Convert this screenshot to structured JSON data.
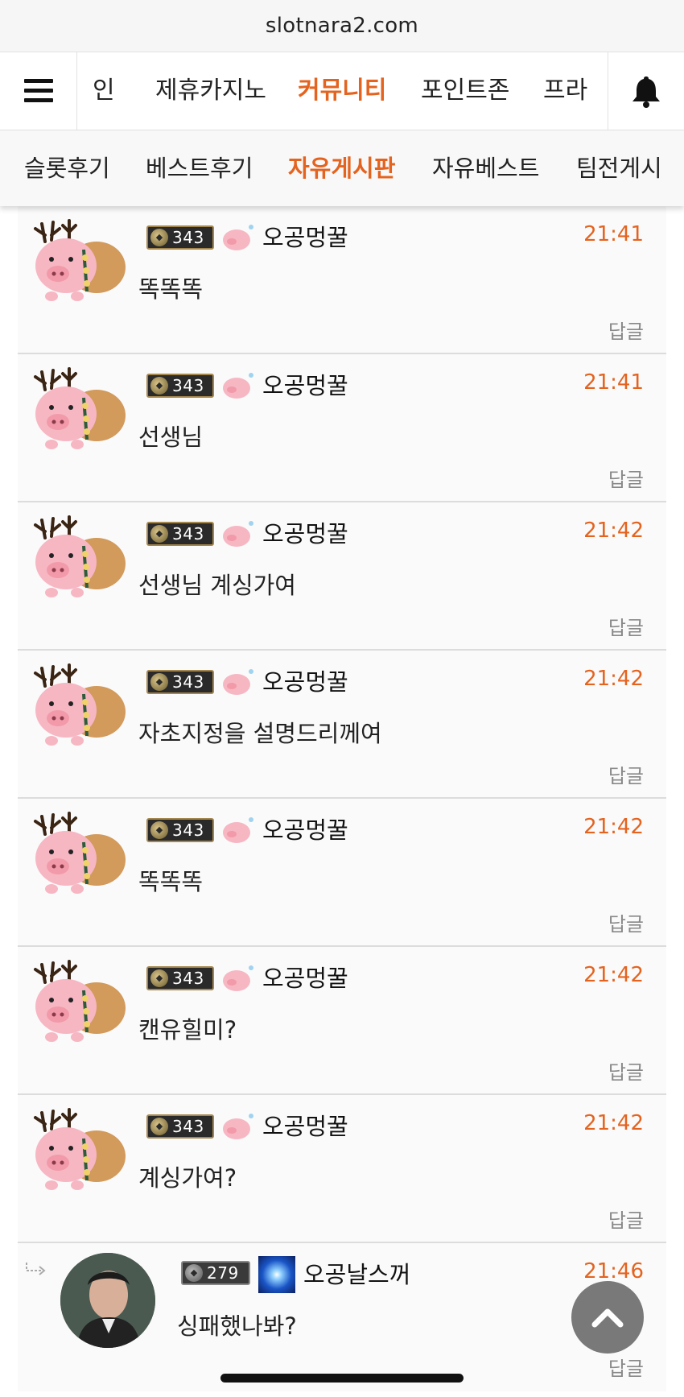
{
  "browser": {
    "url": "slotnara2.com"
  },
  "main_nav": {
    "items": [
      "인",
      "제휴카지노",
      "커뮤니티",
      "포인트존",
      "프라"
    ],
    "active_index": 2
  },
  "sub_nav": {
    "items": [
      "슬롯후기",
      "베스트후기",
      "자유게시판",
      "자유베스트",
      "팀전게시"
    ],
    "active_index": 2
  },
  "comments": [
    {
      "level": "343",
      "nickname": "오공멍꿀",
      "time": "21:41",
      "text": "똑똑똑",
      "reply_label": "답글"
    },
    {
      "level": "343",
      "nickname": "오공멍꿀",
      "time": "21:41",
      "text": "선생님",
      "reply_label": "답글"
    },
    {
      "level": "343",
      "nickname": "오공멍꿀",
      "time": "21:42",
      "text": "선생님 계싱가여",
      "reply_label": "답글"
    },
    {
      "level": "343",
      "nickname": "오공멍꿀",
      "time": "21:42",
      "text": "자초지정을 설명드리께여",
      "reply_label": "답글"
    },
    {
      "level": "343",
      "nickname": "오공멍꿀",
      "time": "21:42",
      "text": "똑똑똑",
      "reply_label": "답글"
    },
    {
      "level": "343",
      "nickname": "오공멍꿀",
      "time": "21:42",
      "text": "캔유힐미?",
      "reply_label": "답글"
    },
    {
      "level": "343",
      "nickname": "오공멍꿀",
      "time": "21:42",
      "text": "계싱가여?",
      "reply_label": "답글"
    }
  ],
  "reply_comment": {
    "level": "279",
    "nickname": "오공날스꺼",
    "time": "21:46",
    "text": "싱패했나봐?",
    "reply_label": "답글"
  },
  "colors": {
    "accent": "#e4631f",
    "divider": "#dcdcdc",
    "reply_gray": "#888888"
  },
  "icons": [
    "hamburger-menu-icon",
    "bell-icon",
    "reindeer-pig-avatar",
    "level-badge-icon",
    "pig-icon",
    "reply-arrow-icon",
    "chevron-up-icon"
  ]
}
